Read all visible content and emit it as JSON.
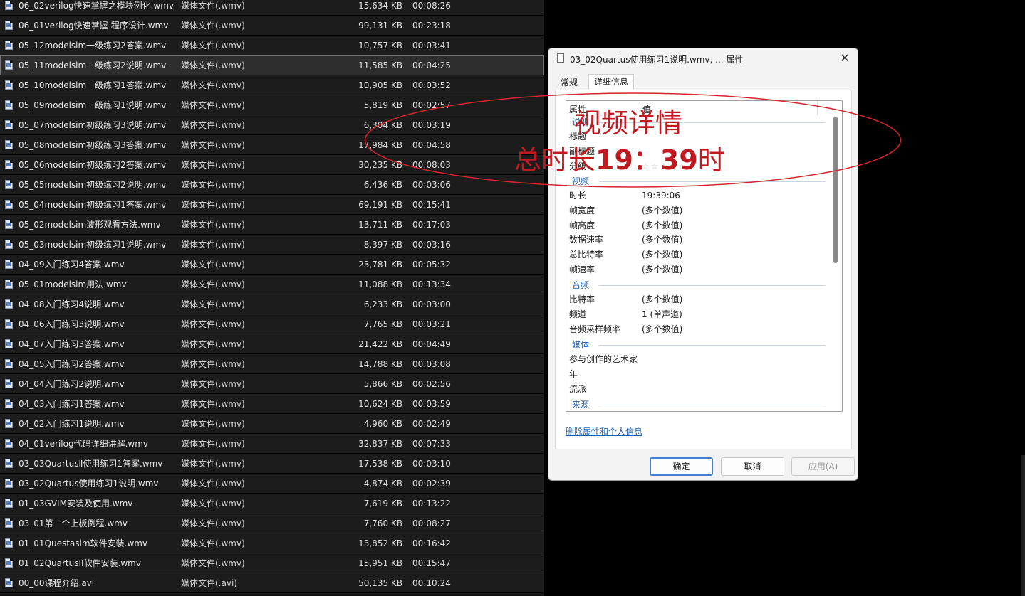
{
  "file_list": {
    "rows": [
      {
        "name": "06_02verilog快速掌握之模块例化.wmv",
        "type": "媒体文件(.wmv)",
        "size": "15,634 KB",
        "duration": "00:08:26"
      },
      {
        "name": "06_01verilog快速掌握-程序设计.wmv",
        "type": "媒体文件(.wmv)",
        "size": "99,131 KB",
        "duration": "00:23:18"
      },
      {
        "name": "05_12modelsim一级练习2答案.wmv",
        "type": "媒体文件(.wmv)",
        "size": "10,757 KB",
        "duration": "00:03:41"
      },
      {
        "name": "05_11modelsim一级练习2说明.wmv",
        "type": "媒体文件(.wmv)",
        "size": "11,585 KB",
        "duration": "00:04:25"
      },
      {
        "name": "05_10modelsim一级练习1答案.wmv",
        "type": "媒体文件(.wmv)",
        "size": "10,905 KB",
        "duration": "00:03:52"
      },
      {
        "name": "05_09modelsim一级练习1说明.wmv",
        "type": "媒体文件(.wmv)",
        "size": "5,819 KB",
        "duration": "00:02:57"
      },
      {
        "name": "05_07modelsim初级练习3说明.wmv",
        "type": "媒体文件(.wmv)",
        "size": "6,304 KB",
        "duration": "00:03:19"
      },
      {
        "name": "05_08modelsim初级练习3答案.wmv",
        "type": "媒体文件(.wmv)",
        "size": "17,984 KB",
        "duration": "00:04:58"
      },
      {
        "name": "05_06modelsim初级练习2答案.wmv",
        "type": "媒体文件(.wmv)",
        "size": "30,235 KB",
        "duration": "00:08:03"
      },
      {
        "name": "05_05modelsim初级练习2说明.wmv",
        "type": "媒体文件(.wmv)",
        "size": "6,436 KB",
        "duration": "00:03:06"
      },
      {
        "name": "05_04modelsim初级练习1答案.wmv",
        "type": "媒体文件(.wmv)",
        "size": "69,191 KB",
        "duration": "00:15:41"
      },
      {
        "name": "05_02modelsim波形观看方法.wmv",
        "type": "媒体文件(.wmv)",
        "size": "13,711 KB",
        "duration": "00:17:03"
      },
      {
        "name": "05_03modelsim初级练习1说明.wmv",
        "type": "媒体文件(.wmv)",
        "size": "8,397 KB",
        "duration": "00:03:16"
      },
      {
        "name": "04_09入门练习4答案.wmv",
        "type": "媒体文件(.wmv)",
        "size": "23,781 KB",
        "duration": "00:05:32"
      },
      {
        "name": "05_01modelsim用法.wmv",
        "type": "媒体文件(.wmv)",
        "size": "11,088 KB",
        "duration": "00:13:34"
      },
      {
        "name": "04_08入门练习4说明.wmv",
        "type": "媒体文件(.wmv)",
        "size": "6,233 KB",
        "duration": "00:03:00"
      },
      {
        "name": "04_06入门练习3说明.wmv",
        "type": "媒体文件(.wmv)",
        "size": "7,765 KB",
        "duration": "00:03:21"
      },
      {
        "name": "04_07入门练习3答案.wmv",
        "type": "媒体文件(.wmv)",
        "size": "21,422 KB",
        "duration": "00:04:49"
      },
      {
        "name": "04_05入门练习2答案.wmv",
        "type": "媒体文件(.wmv)",
        "size": "14,788 KB",
        "duration": "00:03:08"
      },
      {
        "name": "04_04入门练习2说明.wmv",
        "type": "媒体文件(.wmv)",
        "size": "5,866 KB",
        "duration": "00:02:56"
      },
      {
        "name": "04_03入门练习1答案.wmv",
        "type": "媒体文件(.wmv)",
        "size": "10,624 KB",
        "duration": "00:03:59"
      },
      {
        "name": "04_02入门练习1说明.wmv",
        "type": "媒体文件(.wmv)",
        "size": "4,960 KB",
        "duration": "00:02:49"
      },
      {
        "name": "04_01verilog代码详细讲解.wmv",
        "type": "媒体文件(.wmv)",
        "size": "32,837 KB",
        "duration": "00:07:33"
      },
      {
        "name": "03_03QuartusⅡ使用练习1答案.wmv",
        "type": "媒体文件(.wmv)",
        "size": "17,538 KB",
        "duration": "00:03:10"
      },
      {
        "name": "03_02Quartus使用练习1说明.wmv",
        "type": "媒体文件(.wmv)",
        "size": "4,874 KB",
        "duration": "00:02:39"
      },
      {
        "name": "01_03GVIM安装及使用.wmv",
        "type": "媒体文件(.wmv)",
        "size": "7,619 KB",
        "duration": "00:13:22"
      },
      {
        "name": "03_01第一个上板例程.wmv",
        "type": "媒体文件(.wmv)",
        "size": "7,760 KB",
        "duration": "00:08:27"
      },
      {
        "name": "01_01Questasim软件安装.wmv",
        "type": "媒体文件(.wmv)",
        "size": "13,852 KB",
        "duration": "00:16:42"
      },
      {
        "name": "01_02QuartusII软件安装.wmv",
        "type": "媒体文件(.wmv)",
        "size": "15,951 KB",
        "duration": "00:15:47"
      },
      {
        "name": "00_00课程介绍.avi",
        "type": "媒体文件(.avi)",
        "size": "50,135 KB",
        "duration": "00:10:24"
      }
    ]
  },
  "dialog": {
    "title": "03_02Quartus使用练习1说明.wmv, ... 属性",
    "close_glyph": "✕",
    "tabs": [
      {
        "label": "常规"
      },
      {
        "label": "详细信息"
      }
    ],
    "columns": {
      "name": "属性",
      "value": "值"
    },
    "groups": {
      "description": "说明",
      "video": "视频",
      "audio": "音频",
      "media": "媒体",
      "origin": "来源"
    },
    "desc_props": [
      {
        "name": "标题",
        "value": ""
      },
      {
        "name": "副标题",
        "value": ""
      },
      {
        "name": "分级",
        "value": "☆☆☆☆☆"
      }
    ],
    "video_props": [
      {
        "name": "时长",
        "value": "19:39:06"
      },
      {
        "name": "帧宽度",
        "value": "(多个数值)"
      },
      {
        "name": "帧高度",
        "value": "(多个数值)"
      },
      {
        "name": "数据速率",
        "value": "(多个数值)"
      },
      {
        "name": "总比特率",
        "value": "(多个数值)"
      },
      {
        "name": "帧速率",
        "value": "(多个数值)"
      }
    ],
    "audio_props": [
      {
        "name": "比特率",
        "value": "(多个数值)"
      },
      {
        "name": "频道",
        "value": "1 (单声道)"
      },
      {
        "name": "音频采样频率",
        "value": "(多个数值)"
      }
    ],
    "media_props": [
      {
        "name": "参与创作的艺术家",
        "value": ""
      },
      {
        "name": "年",
        "value": ""
      },
      {
        "name": "流派",
        "value": ""
      }
    ],
    "remove_link": "删除属性和个人信息",
    "ok": "确定",
    "cancel": "取消",
    "apply": "应用(A)"
  },
  "annotation": {
    "line1": "视频详情",
    "line2_prefix": "总时长",
    "line2_value": "19：39",
    "line2_suffix": "时",
    "color": "#c0191f"
  }
}
